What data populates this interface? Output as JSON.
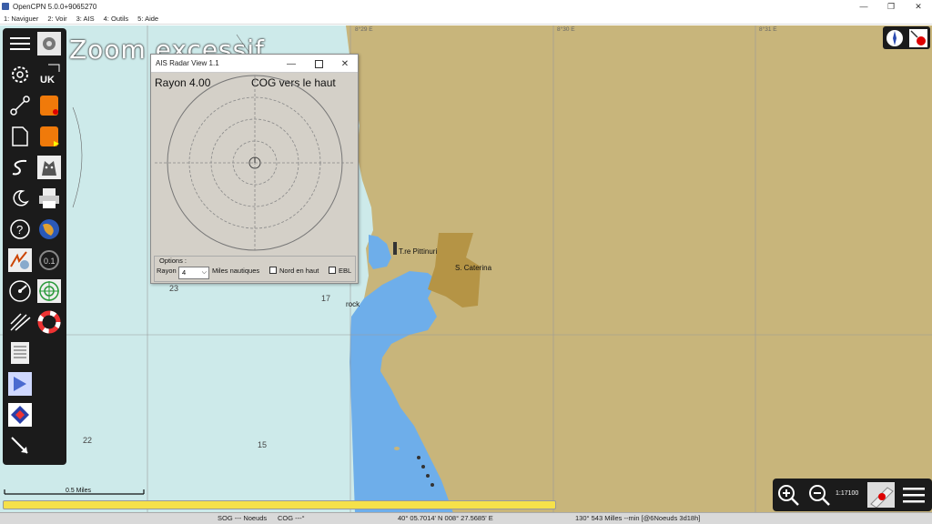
{
  "window": {
    "title": "OpenCPN 5.0.0+9065270",
    "minimize": "—",
    "maximize": "❐",
    "close": "✕"
  },
  "menu": {
    "items": [
      "1: Naviguer",
      "2: Voir",
      "3: AIS",
      "4: Outils",
      "5: Aide"
    ]
  },
  "chart": {
    "overlay_text": "Zoom excessif",
    "grid_labels": [
      "8°29 E",
      "8°30 E",
      "8°31 E"
    ],
    "depths": [
      "23",
      "17",
      "22",
      "15"
    ],
    "places": [
      "T.re Pittinuri",
      "S. Caterina",
      "rock"
    ],
    "scale_label": "0.5 Miles",
    "scale_value": "1:17100",
    "colors": {
      "sea": "#cdeaea",
      "shallow": "#6eaeea",
      "land": "#c8b57b",
      "urban": "#b59445"
    }
  },
  "radar": {
    "title": "AIS Radar View 1.1",
    "range_label": "Rayon 4.00",
    "orientation_label": "COG vers le haut",
    "options_legend": "Options :",
    "range_field_label": "Rayon",
    "range_value": "4",
    "units_label": "Miles nautiques",
    "north_up_label": "Nord en haut",
    "ebl_label": "EBL"
  },
  "status": {
    "sog": "SOG --- Noeuds",
    "cog": "COG ---°",
    "position": "40° 05.7014' N   008° 27.5685' E",
    "cursor": "130°  543 Milles --min [@6Noeuds 3d18h]"
  },
  "progress": 1.0,
  "icons": {
    "toolbar": [
      "menu-icon",
      "chart-quilt-icon",
      "settings-icon",
      "uk-chart-icon",
      "route-icon",
      "waypoint-icon",
      "document-icon",
      "track-icon",
      "ais-plugin-icon",
      "dog-icon",
      "night-mode-icon",
      "print-icon",
      "help-icon",
      "globe-icon",
      "weather-icon",
      "ais-icon",
      "dashboard-icon",
      "radar-icon",
      "route-manager-icon",
      "lifebuoy-icon",
      "logbook-icon",
      "playback-icon",
      "chart-icon",
      "measure-icon"
    ]
  }
}
